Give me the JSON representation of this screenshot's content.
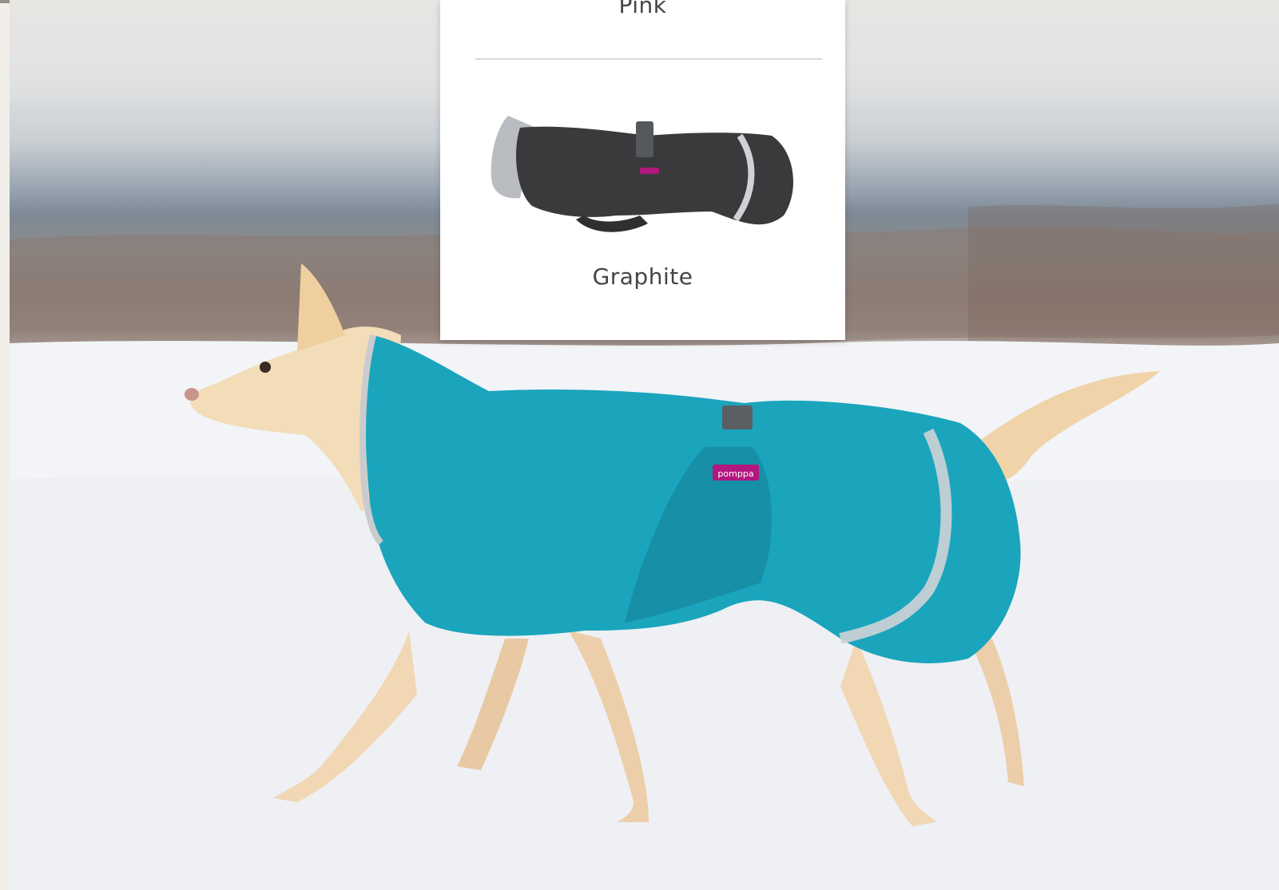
{
  "color_options": [
    {
      "label": "Pink"
    },
    {
      "label": "Graphite"
    }
  ],
  "product_image": {
    "alt": "Dog wearing teal coat walking in snow",
    "coat_color": "#1aa5bd",
    "brand_tag": "pomppa"
  },
  "swatch_colors": {
    "graphite": "#3a3a3c",
    "pink_tag": "#b2177d"
  }
}
